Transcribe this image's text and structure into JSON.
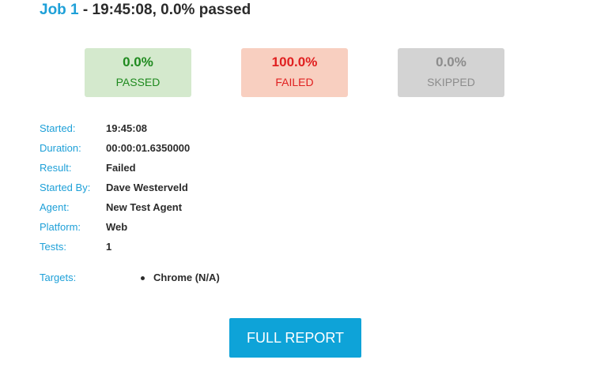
{
  "header": {
    "job_label": "Job 1",
    "title_rest": " - 19:45:08, 0.0% passed"
  },
  "stats": {
    "passed": {
      "percent": "0.0%",
      "label": "PASSED"
    },
    "failed": {
      "percent": "100.0%",
      "label": "FAILED"
    },
    "skipped": {
      "percent": "0.0%",
      "label": "SKIPPED"
    }
  },
  "details": [
    {
      "key": "Started:",
      "value": "19:45:08"
    },
    {
      "key": "Duration:",
      "value": "00:00:01.6350000"
    },
    {
      "key": "Result:",
      "value": "Failed"
    },
    {
      "key": "Started By:",
      "value": "Dave Westerveld"
    },
    {
      "key": "Agent:",
      "value": "New Test Agent"
    },
    {
      "key": "Platform:",
      "value": "Web"
    },
    {
      "key": "Tests:",
      "value": "1"
    }
  ],
  "targets": {
    "key": "Targets:",
    "items": [
      "Chrome (N/A)"
    ]
  },
  "actions": {
    "full_report_label": "FULL REPORT"
  },
  "colors": {
    "accent": "#1ea0d8",
    "button": "#0ea3d8",
    "passed_bg": "#d4e9cd",
    "passed_text": "#1f8a1f",
    "failed_bg": "#f8cfc0",
    "failed_text": "#e02020",
    "skipped_bg": "#d3d3d3",
    "skipped_text": "#8c8c8c"
  }
}
